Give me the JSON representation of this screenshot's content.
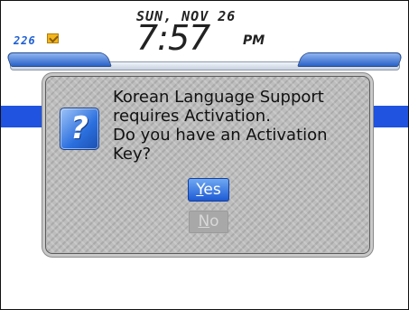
{
  "status_bar": {
    "date": "SUN, NOV 26",
    "time": "7:57",
    "ampm": "PM",
    "message_count": "226",
    "message_icon": "envelope-icon"
  },
  "dialog": {
    "icon": "question-icon",
    "icon_glyph": "?",
    "lines": [
      "Korean Language Support",
      "requires Activation.",
      "Do you have an Activation",
      "Key?"
    ],
    "yes_mnemonic": "Y",
    "yes_rest": "es",
    "no_mnemonic": "N",
    "no_rest": "o"
  },
  "colors": {
    "accent_blue": "#1f53e0",
    "dialog_gray": "#bdbdbd",
    "message_count_blue": "#1e5fd4"
  }
}
